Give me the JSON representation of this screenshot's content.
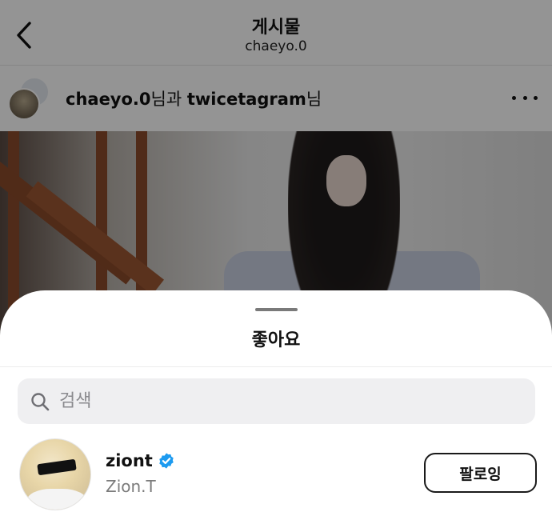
{
  "header": {
    "title": "게시물",
    "subtitle": "chaeyo.0",
    "back_icon": "chevron-left-icon"
  },
  "post": {
    "author_primary": "chaeyo.0",
    "suffix_one": "님과 ",
    "author_secondary": "twicetagram",
    "suffix_two": "님",
    "more_icon": "more-horizontal-icon"
  },
  "likes_sheet": {
    "title": "좋아요",
    "search": {
      "placeholder": "검색",
      "value": "",
      "icon": "search-icon"
    },
    "users": [
      {
        "username": "ziont",
        "full_name": "Zion.T",
        "verified": true,
        "button_label": "팔로잉"
      }
    ]
  },
  "colors": {
    "verified_badge": "#1d9bf0",
    "sheet_background": "#ffffff",
    "search_background": "#efeff1",
    "overlay": "rgba(0,0,0,0.42)"
  }
}
